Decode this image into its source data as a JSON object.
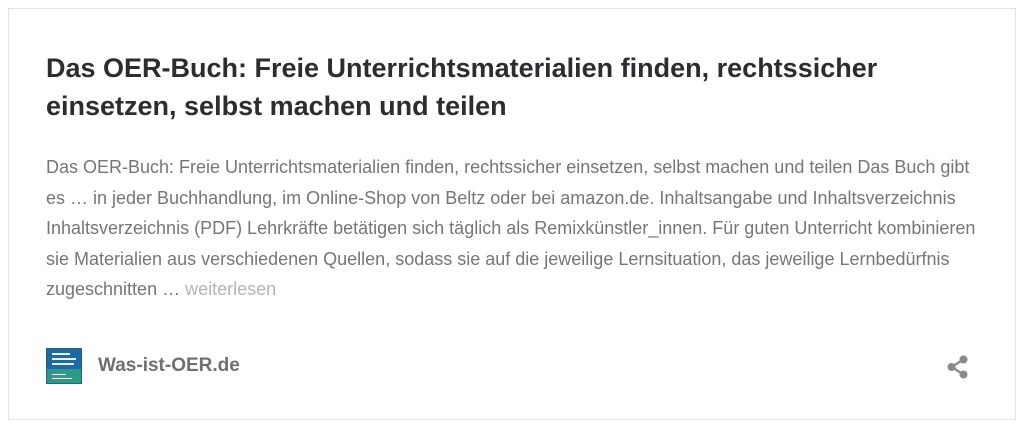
{
  "card": {
    "title": "Das OER-Buch: Freie Unterrichtsmaterialien finden, rechtssicher einsetzen, selbst machen und teilen",
    "excerpt": "Das OER-Buch: Freie Unterrichtsmaterialien finden, rechtssicher einsetzen, selbst machen und teilen Das Buch gibt es … in jeder Buchhandlung, im Online-Shop von Beltz oder bei amazon.de. Inhaltsangabe und Inhaltsverzeichnis Inhaltsverzeichnis (PDF) Lehrkräfte betätigen sich täglich als Remixkünstler_innen. Für guten Unterricht kombinieren sie Materialien aus verschiedenen Quellen, sodass sie auf die jeweilige Lernsituation, das jeweilige Lernbedürfnis zugeschnitten …",
    "read_more": "weiterlesen",
    "source": {
      "name": "Was-ist-OER.de",
      "icon": "book-cover-thumbnail"
    },
    "share_icon": "share-icon"
  },
  "colors": {
    "title": "#2b2d30",
    "excerpt": "#767676",
    "read_more": "#b4b4b4",
    "source": "#6f6f6f",
    "border": "#e2e2e2"
  }
}
